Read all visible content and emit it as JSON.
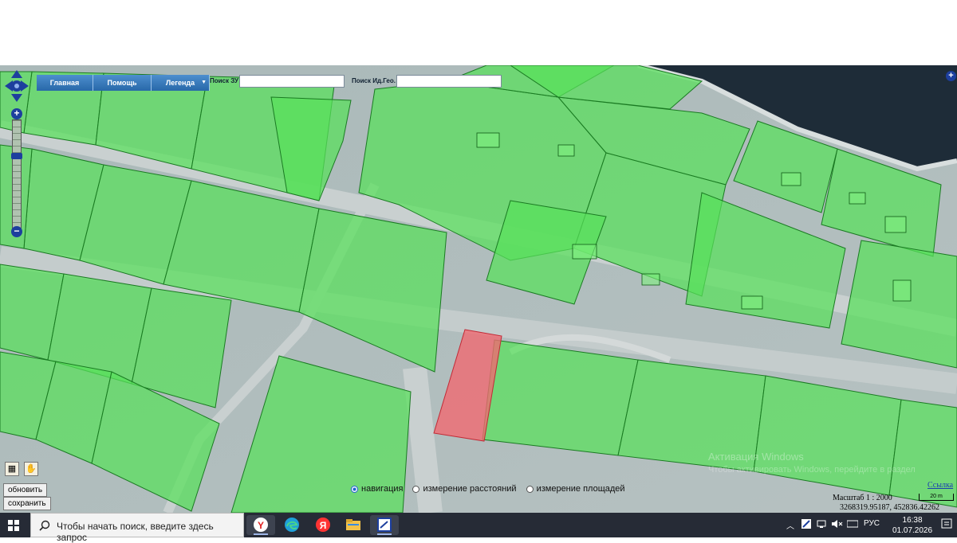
{
  "toolbar": {
    "main_label": "Главная",
    "help_label": "Помощь",
    "legend_label": "Легенда"
  },
  "search": {
    "zu_label": "Поиск ЗУ",
    "geo_label": "Поиск Ид.Гео.",
    "zu_value": "",
    "geo_value": ""
  },
  "actions": {
    "refresh_label": "обновить",
    "save_label": "сохранить"
  },
  "modes": {
    "navigation_label": "навигация",
    "distance_label": "измерение расстояний",
    "area_label": "измерение площадей",
    "selected": "навигация"
  },
  "map": {
    "scale_label": "Масштаб 1 : 2000",
    "coordinates": "3268319.95187, 452836.42262",
    "link_label": "Ссылка",
    "scalebar_label": "20 m",
    "watermark_line1": "Активация Windows",
    "watermark_line2": "Чтобы активировать Windows, перейдите в раздел"
  },
  "taskbar": {
    "search_placeholder": "Чтобы начать поиск, введите здесь запрос",
    "language": "РУС",
    "time": "16:38",
    "date": "01.07.2026",
    "apps": [
      "yandex-browser",
      "edge",
      "yandex",
      "file-explorer",
      "app-window"
    ]
  },
  "colors": {
    "parcel_fill": "#57e05a",
    "parcel_stroke": "#1a7a22",
    "selected_fill": "#f06a72",
    "toolbar_blue": "#2f72b8",
    "water": "#1d2b36",
    "taskbar": "#262b36"
  }
}
